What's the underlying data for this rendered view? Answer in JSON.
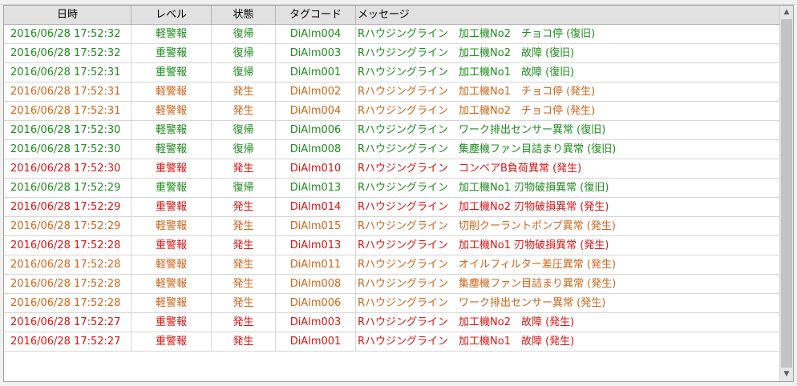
{
  "columns": [
    "日時",
    "レベル",
    "状態",
    "タグコード",
    "メッセージ"
  ],
  "colors": {
    "green": "#1e8c1e",
    "orange": "#d0661a",
    "red": "#dc1414"
  },
  "rows": [
    {
      "datetime": "2016/06/28 17:52:32",
      "level": "軽警報",
      "state": "復帰",
      "tag": "DiAlm004",
      "message": "Rハウジングライン　加工機No2　チョコ停 (復旧)",
      "color": "green"
    },
    {
      "datetime": "2016/06/28 17:52:32",
      "level": "重警報",
      "state": "復帰",
      "tag": "DiAlm003",
      "message": "Rハウジングライン　加工機No2　故障 (復旧)",
      "color": "green"
    },
    {
      "datetime": "2016/06/28 17:52:31",
      "level": "重警報",
      "state": "復帰",
      "tag": "DiAlm001",
      "message": "Rハウジングライン　加工機No1　故障 (復旧)",
      "color": "green"
    },
    {
      "datetime": "2016/06/28 17:52:31",
      "level": "軽警報",
      "state": "発生",
      "tag": "DiAlm002",
      "message": "Rハウジングライン　加工機No1　チョコ停 (発生)",
      "color": "orange"
    },
    {
      "datetime": "2016/06/28 17:52:31",
      "level": "軽警報",
      "state": "発生",
      "tag": "DiAlm004",
      "message": "Rハウジングライン　加工機No2　チョコ停 (発生)",
      "color": "orange"
    },
    {
      "datetime": "2016/06/28 17:52:30",
      "level": "軽警報",
      "state": "復帰",
      "tag": "DiAlm006",
      "message": "Rハウジングライン　ワーク排出センサー異常 (復旧)",
      "color": "green"
    },
    {
      "datetime": "2016/06/28 17:52:30",
      "level": "軽警報",
      "state": "復帰",
      "tag": "DiAlm008",
      "message": "Rハウジングライン　集塵機ファン目詰まり異常 (復旧)",
      "color": "green"
    },
    {
      "datetime": "2016/06/28 17:52:30",
      "level": "重警報",
      "state": "発生",
      "tag": "DiAlm010",
      "message": "Rハウジングライン　コンベアB負荷異常 (発生)",
      "color": "red"
    },
    {
      "datetime": "2016/06/28 17:52:29",
      "level": "重警報",
      "state": "復帰",
      "tag": "DiAlm013",
      "message": "Rハウジングライン　加工機No1 刃物破損異常 (復旧)",
      "color": "green"
    },
    {
      "datetime": "2016/06/28 17:52:29",
      "level": "重警報",
      "state": "発生",
      "tag": "DiAlm014",
      "message": "Rハウジングライン　加工機No2 刃物破損異常 (発生)",
      "color": "red"
    },
    {
      "datetime": "2016/06/28 17:52:29",
      "level": "軽警報",
      "state": "発生",
      "tag": "DiAlm015",
      "message": "Rハウジングライン　切削クーラントポンプ異常 (発生)",
      "color": "orange"
    },
    {
      "datetime": "2016/06/28 17:52:28",
      "level": "重警報",
      "state": "発生",
      "tag": "DiAlm013",
      "message": "Rハウジングライン　加工機No1 刃物破損異常 (発生)",
      "color": "red"
    },
    {
      "datetime": "2016/06/28 17:52:28",
      "level": "軽警報",
      "state": "発生",
      "tag": "DiAlm011",
      "message": "Rハウジングライン　オイルフィルター差圧異常 (発生)",
      "color": "orange"
    },
    {
      "datetime": "2016/06/28 17:52:28",
      "level": "軽警報",
      "state": "発生",
      "tag": "DiAlm008",
      "message": "Rハウジングライン　集塵機ファン目詰まり異常 (発生)",
      "color": "orange"
    },
    {
      "datetime": "2016/06/28 17:52:28",
      "level": "軽警報",
      "state": "発生",
      "tag": "DiAlm006",
      "message": "Rハウジングライン　ワーク排出センサー異常 (発生)",
      "color": "orange"
    },
    {
      "datetime": "2016/06/28 17:52:27",
      "level": "重警報",
      "state": "発生",
      "tag": "DiAlm003",
      "message": "Rハウジングライン　加工機No2　故障 (発生)",
      "color": "red"
    },
    {
      "datetime": "2016/06/28 17:52:27",
      "level": "重警報",
      "state": "発生",
      "tag": "DiAlm001",
      "message": "Rハウジングライン　加工機No1　故障 (発生)",
      "color": "red"
    }
  ],
  "scrollbar": {
    "up_icon": "▲",
    "down_icon": "▼"
  }
}
